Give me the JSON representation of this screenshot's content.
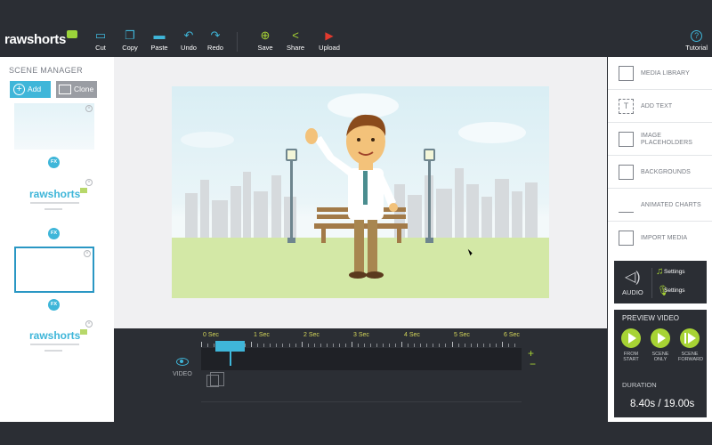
{
  "app": {
    "logo_text": "rawshorts"
  },
  "toolbar": {
    "cut": "Cut",
    "copy": "Copy",
    "paste": "Paste",
    "undo": "Undo",
    "redo": "Redo",
    "save": "Save",
    "share": "Share",
    "upload": "Upload",
    "tutorial": "Tutorial"
  },
  "scene_manager": {
    "title": "SCENE MANAGER",
    "add_label": "Add",
    "clone_label": "Clone",
    "fx_label": "FX",
    "thumb_logo": "rawshorts"
  },
  "timeline": {
    "seconds": [
      "0 Sec",
      "1 Sec",
      "2 Sec",
      "3 Sec",
      "4 Sec",
      "5 Sec",
      "6 Sec"
    ],
    "video_label": "VIDEO",
    "zoom_in": "+",
    "zoom_out": "−"
  },
  "right_panel": {
    "items": [
      {
        "label": "MEDIA LIBRARY",
        "icon": "media-library-icon"
      },
      {
        "label": "ADD TEXT",
        "icon": "text-icon"
      },
      {
        "label": "IMAGE PLACEHOLDERS",
        "icon": "image-placeholder-icon"
      },
      {
        "label": "BACKGROUNDS",
        "icon": "background-icon"
      },
      {
        "label": "ANIMATED CHARTS",
        "icon": "chart-icon"
      },
      {
        "label": "IMPORT MEDIA",
        "icon": "import-icon"
      }
    ],
    "audio_label": "AUDIO",
    "music_settings": "Settings",
    "voice_settings": "Settings",
    "preview_title": "PREVIEW VIDEO",
    "preview_buttons": [
      {
        "label": "FROM START"
      },
      {
        "label": "SCENE ONLY"
      },
      {
        "label": "SCENE FORWARD"
      }
    ],
    "duration_title": "DURATION",
    "duration_value": "8.40s / 19.00s"
  },
  "colors": {
    "accent": "#3fb6d9",
    "green": "#a7d334",
    "dark": "#2b2e34"
  }
}
